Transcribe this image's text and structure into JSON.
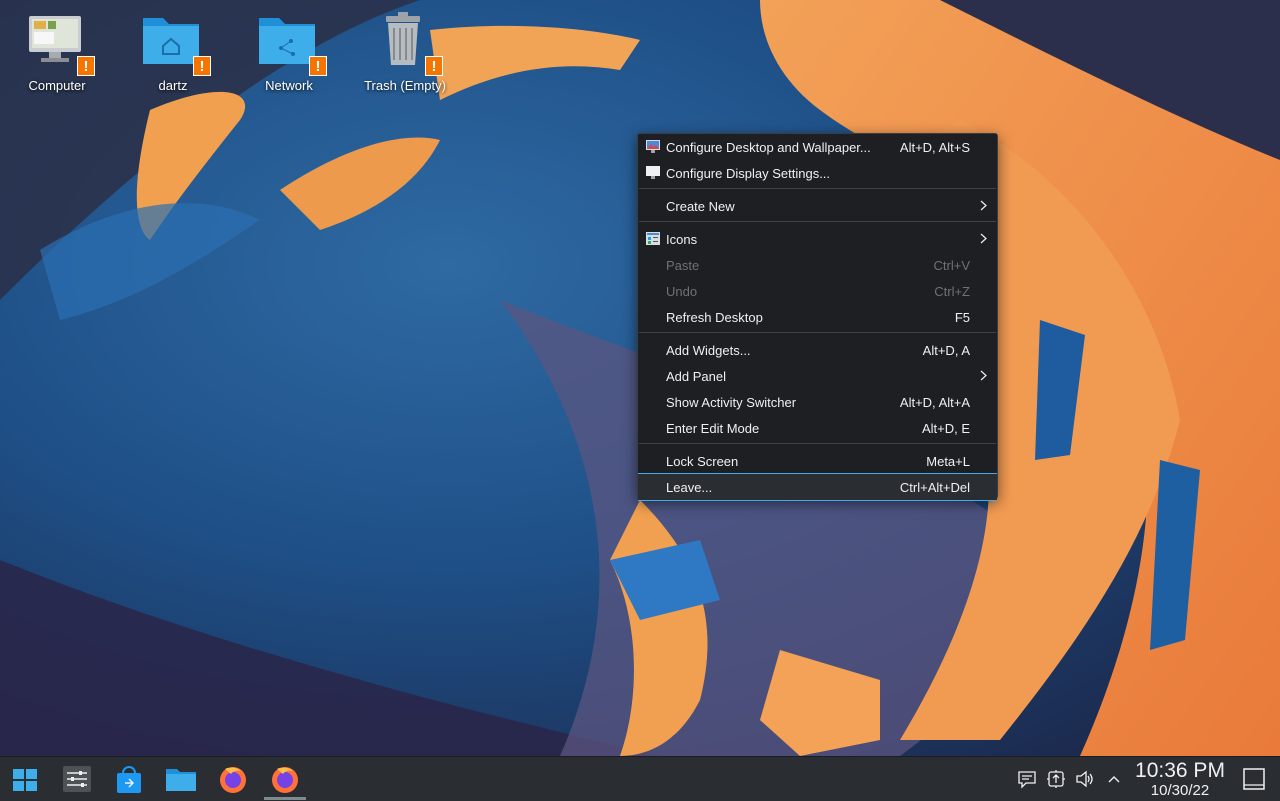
{
  "desktop": {
    "icons": [
      {
        "label": "Computer",
        "icon": "computer-icon"
      },
      {
        "label": "dartz",
        "icon": "home-folder-icon"
      },
      {
        "label": "Network",
        "icon": "network-folder-icon"
      },
      {
        "label": "Trash (Empty)",
        "icon": "trash-icon"
      }
    ],
    "warning_badge": "!"
  },
  "context_menu": {
    "items": [
      {
        "label": "Configure Desktop and Wallpaper...",
        "shortcut": "Alt+D, Alt+S",
        "icon": "wallpaper-settings-icon"
      },
      {
        "label": "Configure Display Settings...",
        "shortcut": "",
        "icon": "display-icon"
      },
      {
        "label": "Create New",
        "shortcut": "",
        "submenu": true
      },
      {
        "label": "Icons",
        "shortcut": "",
        "icon": "icons-view-icon",
        "submenu": true
      },
      {
        "label": "Paste",
        "shortcut": "Ctrl+V",
        "disabled": true
      },
      {
        "label": "Undo",
        "shortcut": "Ctrl+Z",
        "disabled": true
      },
      {
        "label": "Refresh Desktop",
        "shortcut": "F5"
      },
      {
        "label": "Add Widgets...",
        "shortcut": "Alt+D, A"
      },
      {
        "label": "Add Panel",
        "shortcut": "",
        "submenu": true
      },
      {
        "label": "Show Activity Switcher",
        "shortcut": "Alt+D, Alt+A"
      },
      {
        "label": "Enter Edit Mode",
        "shortcut": "Alt+D, E"
      },
      {
        "label": "Lock Screen",
        "shortcut": "Meta+L"
      },
      {
        "label": "Leave...",
        "shortcut": "Ctrl+Alt+Del",
        "highlighted": true
      }
    ]
  },
  "taskbar": {
    "launchers": [
      "start-menu-icon",
      "system-settings-icon",
      "discover-store-icon",
      "file-manager-icon",
      "firefox-icon",
      "firefox-running-icon"
    ],
    "tray": [
      "notifications-icon",
      "updates-icon",
      "volume-icon",
      "expand-tray-icon"
    ],
    "clock": {
      "time": "10:36 PM",
      "date": "10/30/22"
    },
    "show_desktop": "show-desktop-icon"
  },
  "colors": {
    "accent": "#3daee9",
    "warning": "#f67400",
    "menu_bg": "#1d1f22",
    "panel_bg": "#2a2e32"
  }
}
